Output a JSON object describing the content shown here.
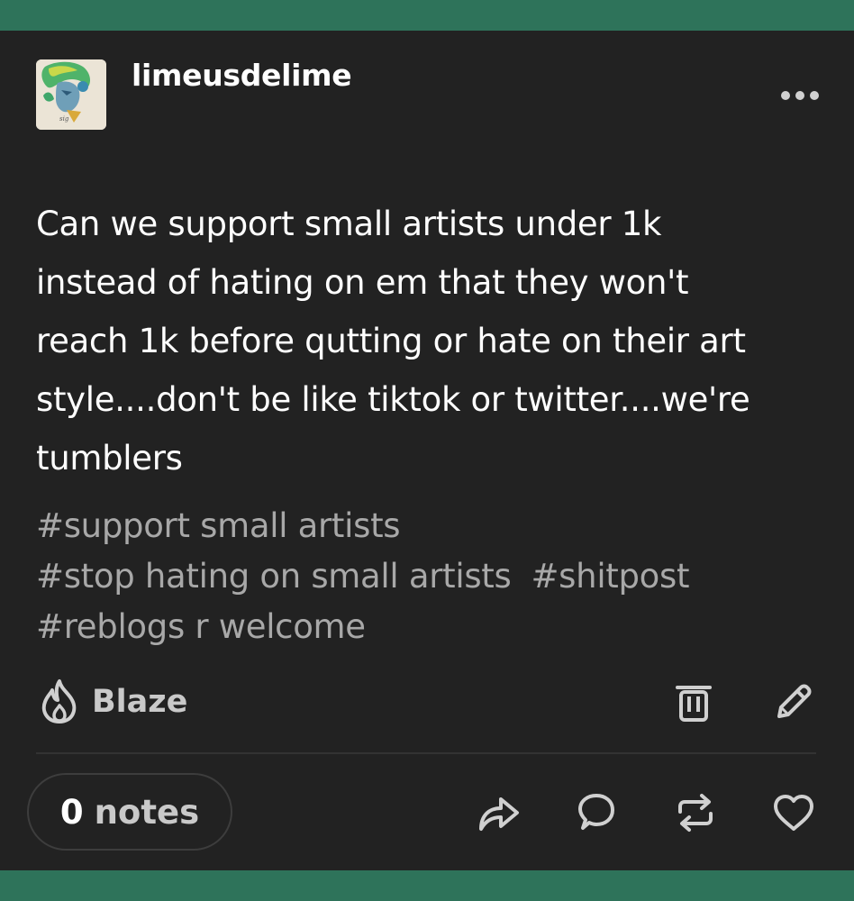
{
  "post": {
    "username": "limeusdelime",
    "body": "Can we support small artists under 1k instead of hating on em that they won't reach 1k before qutting or hate on their art style....don't be like tiktok or twitter....we're tumblers",
    "body_lines": [
      "Can we support small artists under 1k",
      "instead of hating on em that they won't",
      "reach 1k before qutting or hate on their art",
      "style....don't be like tiktok or twitter....we're",
      "tumblers"
    ],
    "tags": [
      "#support small artists",
      "#stop hating on small artists",
      "#shitpost",
      "#reblogs r welcome"
    ]
  },
  "actions": {
    "blaze_label": "Blaze",
    "notes_count": "0",
    "notes_label": "notes"
  },
  "icons": {
    "more": "more-dots-icon",
    "blaze": "flame-icon",
    "delete": "trash-icon",
    "edit": "pencil-icon",
    "share": "share-arrow-icon",
    "reply": "speech-bubble-icon",
    "reblog": "reblog-icon",
    "like": "heart-icon"
  },
  "colors": {
    "frame": "#2e735a",
    "card": "#222222",
    "text": "#ffffff",
    "tags": "#a8a8a8",
    "icons": "#d0d0d0"
  }
}
